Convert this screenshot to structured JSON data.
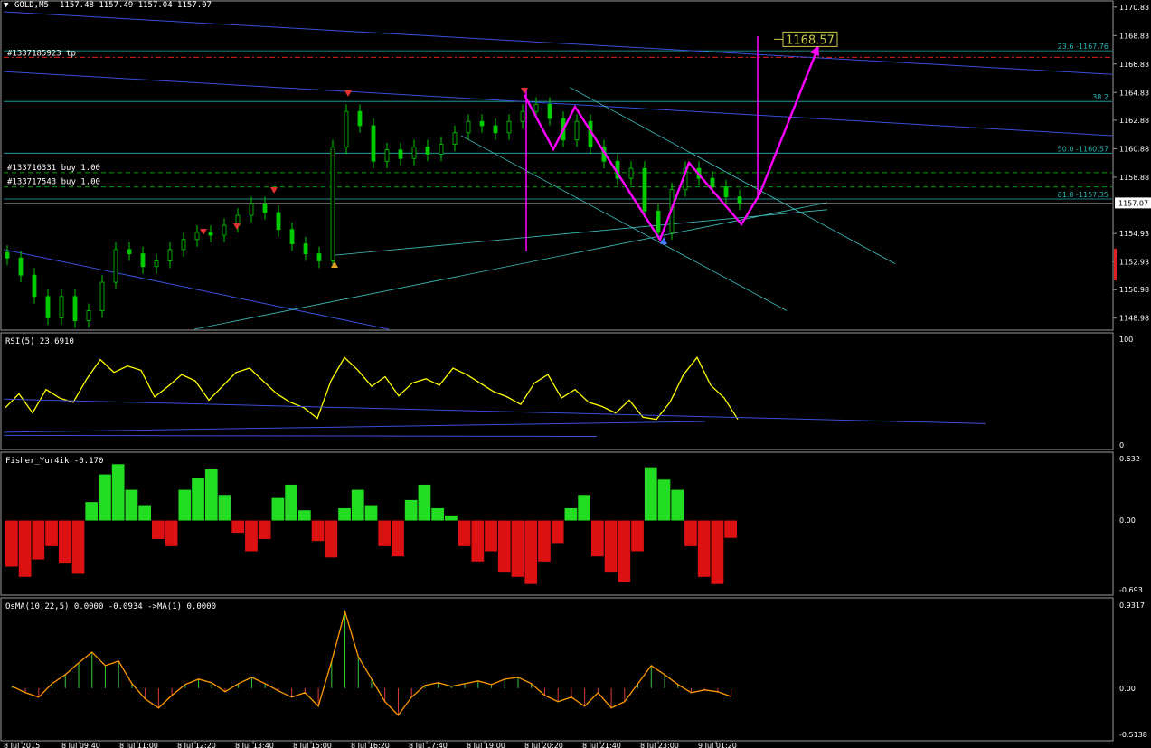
{
  "window": {
    "symbol_label": "GOLD,M5",
    "ohlc": "1157.48 1157.49 1157.04 1157.07",
    "collapse_glyph": "▼"
  },
  "price_axis": {
    "ticks": [
      "1170.83",
      "1168.83",
      "1166.83",
      "1164.83",
      "1162.88",
      "1160.88",
      "1158.88",
      "1157.07",
      "1154.93",
      "1152.93",
      "1150.98",
      "1148.98"
    ],
    "current_price": "1157.07"
  },
  "fibonacci": [
    {
      "label": "23.6 -1167.76",
      "price": 1167.76
    },
    {
      "label": "38.2",
      "price": 1164.2
    },
    {
      "label": "50.0 -1160.57",
      "price": 1160.57
    },
    {
      "label": "61.8 -1157.35",
      "price": 1157.35
    }
  ],
  "orders": [
    {
      "label": "#133716331 buy 1.00",
      "price": 1159.2
    },
    {
      "label": "#133717543 buy 1.00",
      "price": 1158.2
    },
    {
      "label": "#1337185923 tp",
      "price": 1167.3
    }
  ],
  "target_box": {
    "label": "1168.57",
    "price": 1168.57
  },
  "rsi": {
    "label": "RSI(5) 23.6910",
    "ticks": [
      "100",
      "0"
    ]
  },
  "fisher": {
    "label": "Fisher_Yur4ik -0.170",
    "ticks": [
      "0.632",
      "0.00",
      "-0.693"
    ]
  },
  "osma": {
    "label": "OsMA(10,22,5) 0.0000 -0.0934  ->MA(1) 0.0000",
    "ticks": [
      "0.9317",
      "0.00",
      "-0.5138"
    ]
  },
  "time_axis": [
    "8 Jul 2015",
    "8 Jul 09:40",
    "8 Jul 11:00",
    "8 Jul 12:20",
    "8 Jul 13:40",
    "8 Jul 15:00",
    "8 Jul 16:20",
    "8 Jul 17:40",
    "8 Jul 19:00",
    "8 Jul 20:20",
    "8 Jul 21:40",
    "8 Jul 23:00",
    "9 Jul 01:20"
  ],
  "colors": {
    "bull_candle": "#00cc00",
    "bear_candle": "#00cc00",
    "fibo": "#2ab5b5",
    "order_line": "#00a000",
    "tp_line": "#e02020",
    "trend_blue": "#3a4fd8",
    "channel": "#40c0c0",
    "projection": "#ff00ff",
    "rsi_line": "#ffff00",
    "fisher_up": "#22dd22",
    "fisher_down": "#dd1111",
    "osma_line": "#ff9900"
  },
  "chart_data": [
    {
      "type": "candlestick",
      "title": "GOLD,M5",
      "ylim": [
        1148.2,
        1171.2
      ],
      "series": [
        {
          "name": "GOLD,M5",
          "values_close": [
            1153.2,
            1152.0,
            1150.5,
            1149.0,
            1150.5,
            1148.8,
            1149.5,
            1151.5,
            1153.8,
            1153.5,
            1152.6,
            1153.0,
            1153.8,
            1154.5,
            1155.0,
            1154.8,
            1155.5,
            1156.2,
            1157.0,
            1156.4,
            1155.2,
            1154.2,
            1153.5,
            1153.0,
            1161.0,
            1163.5,
            1162.5,
            1160.0,
            1160.8,
            1160.2,
            1161.0,
            1160.5,
            1161.2,
            1162.0,
            1162.8,
            1162.5,
            1162.0,
            1162.8,
            1163.5,
            1164.0,
            1163.0,
            1161.5,
            1162.8,
            1161.0,
            1160.0,
            1158.8,
            1159.5,
            1156.5,
            1155.0,
            1158.0,
            1159.5,
            1158.8,
            1158.2,
            1157.5,
            1157.07
          ]
        }
      ],
      "fib_levels": [
        1167.76,
        1164.2,
        1160.57,
        1157.35
      ],
      "projection_target": 1168.57
    },
    {
      "type": "line",
      "title": "RSI(5) 23.6910",
      "ylim": [
        0,
        100
      ],
      "series": [
        {
          "name": "RSI(5)",
          "values": [
            35,
            48,
            30,
            52,
            44,
            40,
            62,
            80,
            68,
            74,
            70,
            45,
            55,
            66,
            60,
            42,
            55,
            68,
            72,
            60,
            48,
            40,
            35,
            25,
            60,
            82,
            70,
            55,
            64,
            46,
            58,
            62,
            56,
            72,
            66,
            58,
            50,
            45,
            38,
            58,
            66,
            44,
            52,
            40,
            36,
            30,
            42,
            26,
            24,
            40,
            66,
            82,
            56,
            44,
            24
          ]
        }
      ]
    },
    {
      "type": "bar",
      "title": "Fisher_Yur4ik -0.170",
      "ylim": [
        -0.693,
        0.632
      ],
      "series": [
        {
          "name": "Fisher_Yur4ik",
          "values": [
            -0.45,
            -0.55,
            -0.38,
            -0.25,
            -0.42,
            -0.52,
            0.18,
            0.45,
            0.55,
            0.3,
            0.15,
            -0.18,
            -0.25,
            0.3,
            0.42,
            0.5,
            0.25,
            -0.12,
            -0.3,
            -0.18,
            0.22,
            0.35,
            0.1,
            -0.2,
            -0.36,
            0.12,
            0.3,
            0.15,
            -0.25,
            -0.35,
            0.2,
            0.35,
            0.12,
            0.05,
            -0.25,
            -0.4,
            -0.3,
            -0.5,
            -0.55,
            -0.62,
            -0.4,
            -0.22,
            0.12,
            0.25,
            -0.35,
            -0.5,
            -0.6,
            -0.3,
            0.52,
            0.4,
            0.3,
            -0.25,
            -0.55,
            -0.62,
            -0.17
          ]
        }
      ]
    },
    {
      "type": "bar",
      "title": "OsMA(10,22,5) 0.0000 -0.0934  ->MA(1) 0.0000",
      "ylim": [
        -0.5138,
        0.9317
      ],
      "series": [
        {
          "name": "OsMA",
          "values": [
            0.02,
            -0.05,
            -0.1,
            0.05,
            0.15,
            0.28,
            0.4,
            0.25,
            0.3,
            0.05,
            -0.12,
            -0.22,
            -0.08,
            0.04,
            0.1,
            0.06,
            -0.04,
            0.05,
            0.12,
            0.05,
            -0.03,
            -0.1,
            -0.05,
            -0.2,
            0.3,
            0.85,
            0.35,
            0.1,
            -0.15,
            -0.3,
            -0.1,
            0.03,
            0.06,
            0.02,
            0.05,
            0.08,
            0.04,
            0.1,
            0.12,
            0.05,
            -0.08,
            -0.15,
            -0.1,
            -0.2,
            -0.05,
            -0.22,
            -0.15,
            0.05,
            0.25,
            0.15,
            0.04,
            -0.05,
            -0.02,
            -0.04,
            -0.093
          ]
        }
      ]
    }
  ]
}
